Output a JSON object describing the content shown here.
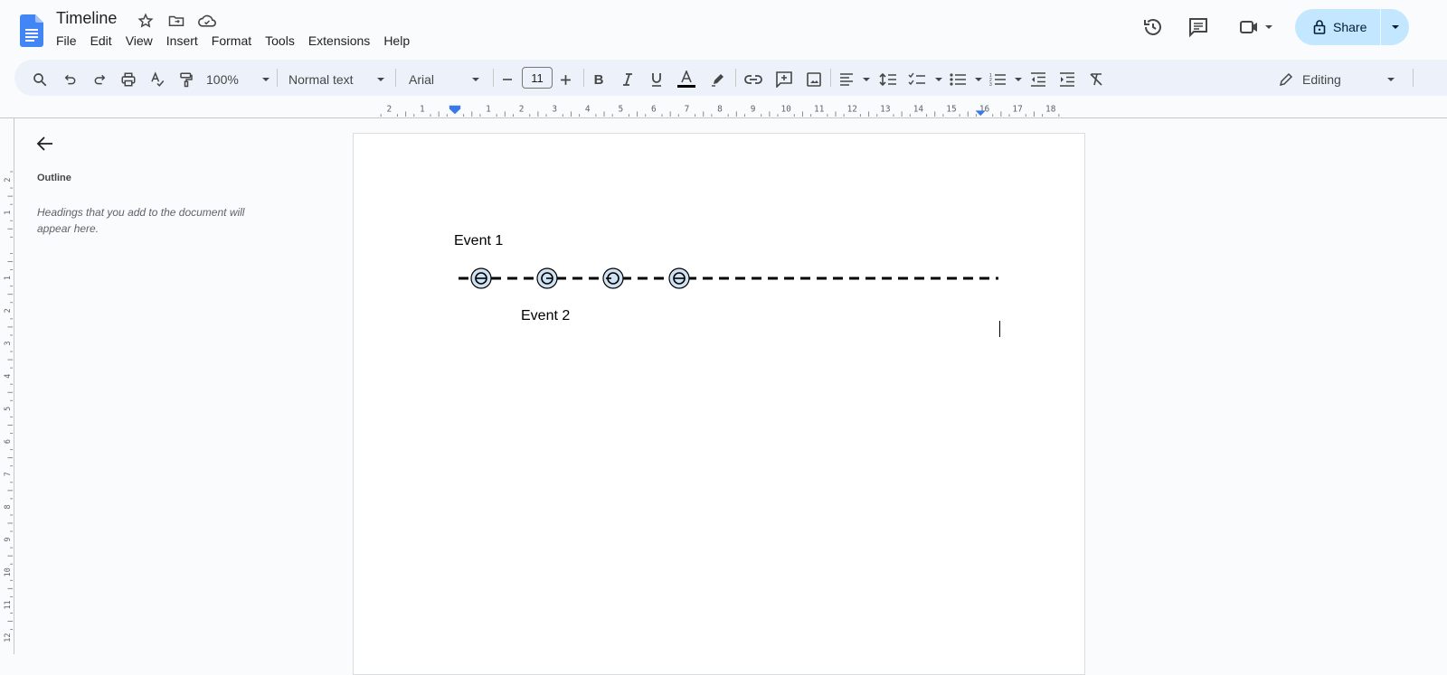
{
  "app": {
    "title": "Timeline",
    "title_icons": [
      "star-icon",
      "move-to-folder-icon",
      "cloud-saved-icon"
    ],
    "menu": [
      "File",
      "Edit",
      "View",
      "Insert",
      "Format",
      "Tools",
      "Extensions",
      "Help"
    ],
    "header_right": {
      "icons": [
        "version-history-icon",
        "comments-icon",
        "meet-video-icon"
      ],
      "share_label": "Share",
      "brand_color": "#c2e7ff"
    }
  },
  "toolbar": {
    "zoom": "100%",
    "style": "Normal text",
    "font": "Arial",
    "font_size": "11",
    "mode": "Editing",
    "icons": [
      "search-icon",
      "undo-icon",
      "redo-icon",
      "print-icon",
      "spellcheck-icon",
      "paint-format-icon",
      "bold-icon",
      "italic-icon",
      "underline-icon",
      "text-color-icon",
      "highlight-icon",
      "link-icon",
      "add-comment-icon",
      "insert-image-icon",
      "align-icon",
      "line-spacing-icon",
      "checklist-icon",
      "bulleted-list-icon",
      "numbered-list-icon",
      "decrease-indent-icon",
      "increase-indent-icon",
      "clear-formatting-icon"
    ]
  },
  "ruler": {
    "horizontal_labels": [
      "2",
      "1",
      "1",
      "2",
      "3",
      "4",
      "5",
      "6",
      "7",
      "8",
      "9",
      "10",
      "11",
      "12",
      "13",
      "14",
      "15",
      "16",
      "17",
      "18"
    ],
    "vertical_labels": [
      "2",
      "1",
      "1",
      "2",
      "3",
      "4",
      "5",
      "6",
      "7",
      "8",
      "9",
      "10",
      "11",
      "12"
    ]
  },
  "outline": {
    "title": "Outline",
    "hint": "Headings that you add to the document will appear here."
  },
  "document": {
    "event1": "Event 1",
    "event2": "Event 2",
    "timeline_fill": "#cfe2f3"
  }
}
